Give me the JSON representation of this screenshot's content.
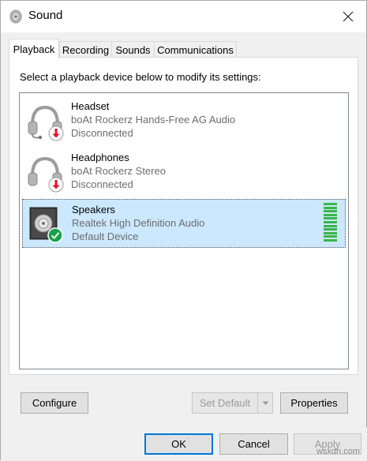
{
  "window": {
    "title": "Sound"
  },
  "tabs": [
    {
      "label": "Playback",
      "active": true
    },
    {
      "label": "Recording",
      "active": false
    },
    {
      "label": "Sounds",
      "active": false
    },
    {
      "label": "Communications",
      "active": false
    }
  ],
  "instructions": "Select a playback device below to modify its settings:",
  "devices": [
    {
      "name": "Headset",
      "driver": "boAt Rockerz Hands-Free AG Audio",
      "status": "Disconnected",
      "icon": "headset-icon",
      "badge": "disconnected-badge-icon"
    },
    {
      "name": "Headphones",
      "driver": "boAt Rockerz Stereo",
      "status": "Disconnected",
      "icon": "headphones-icon",
      "badge": "disconnected-badge-icon"
    },
    {
      "name": "Speakers",
      "driver": "Realtek High Definition Audio",
      "status": "Default Device",
      "icon": "speaker-icon",
      "badge": "default-check-icon",
      "selected": true,
      "level_meter_bars": 11
    }
  ],
  "buttons": {
    "configure": "Configure",
    "set_default": "Set Default",
    "properties": "Properties",
    "ok": "OK",
    "cancel": "Cancel",
    "apply": "Apply"
  },
  "watermark": "wsxdn.com",
  "colors": {
    "selection": "#cce8ff",
    "accent": "#0078d7",
    "level": "#39b54a",
    "disconnected": "#e81123",
    "default_check": "#16a34a"
  }
}
